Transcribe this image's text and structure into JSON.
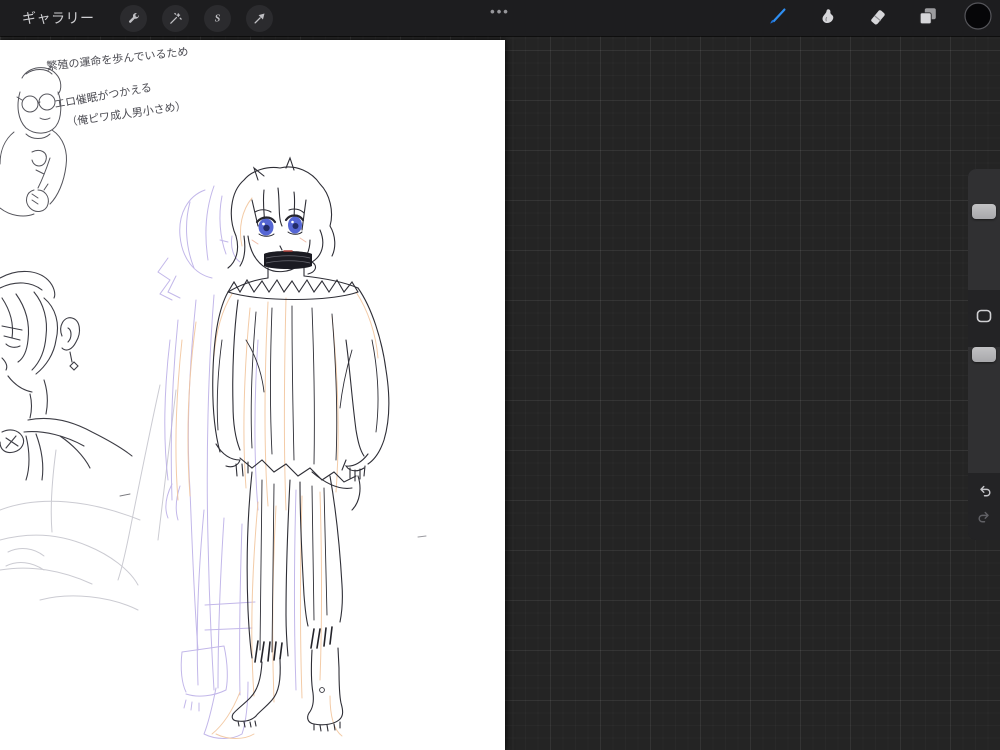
{
  "toolbar": {
    "gallery_label": "ギャラリー",
    "ellipsis": "•••",
    "selection_glyph": "S",
    "left_icons": [
      "wrench-icon",
      "adjustments-wand-icon",
      "selection-s-icon",
      "transform-arrow-icon"
    ],
    "right_icons": [
      "brush-icon",
      "smudge-icon",
      "eraser-icon",
      "layers-icon",
      "color-swatch"
    ],
    "active_tool": "brush",
    "accent_color": "#2f8ff2",
    "color_swatch": "#060608"
  },
  "sidebar": {
    "controls": [
      "brush-size-slider",
      "modify-button",
      "opacity-slider",
      "undo-button",
      "redo-button"
    ]
  },
  "canvas": {
    "background": "#ffffff",
    "annotations": {
      "line1": "繁殖の運命を歩んでいるため",
      "line2": "エロ催眠がつかえる",
      "line3": "（俺ピワ成人男小さめ）"
    }
  },
  "colors": {
    "toolbar_bg": "#1d1d1f",
    "workspace_bg": "#242424",
    "sketch_line": "#2e2e36",
    "sketch_lavender": "#b8abe6",
    "sketch_orange": "#f2c69e",
    "sketch_faint": "#cbcbd2"
  }
}
